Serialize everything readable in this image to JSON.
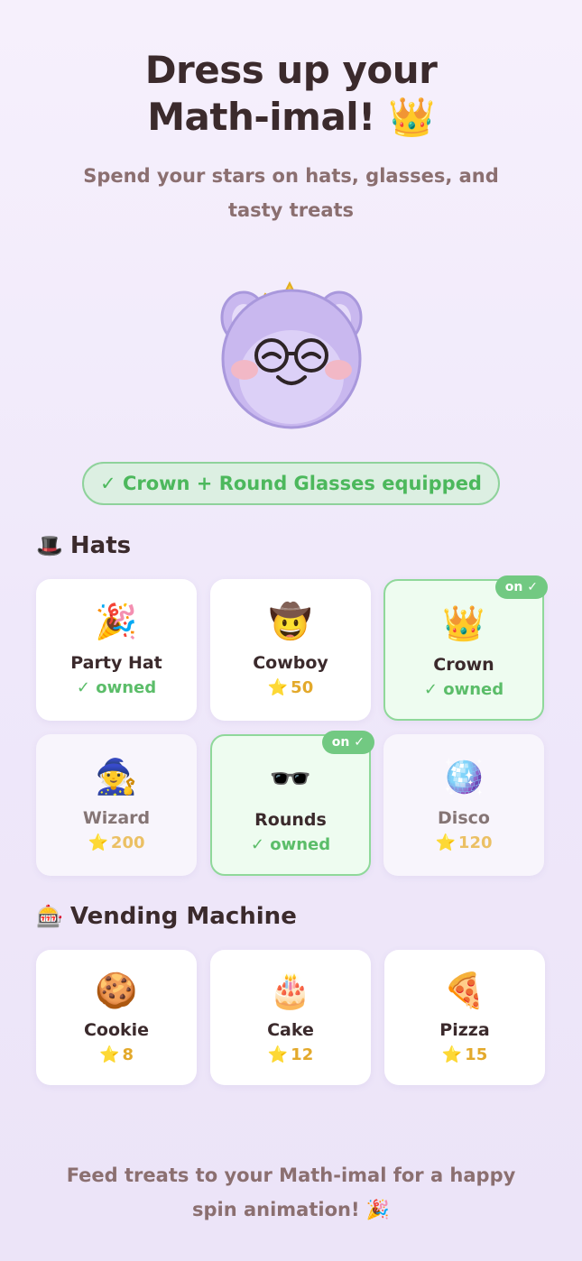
{
  "header": {
    "title_line1": "Dress up your",
    "title_line2": "Math-imal! 👑",
    "subtitle": "Spend your stars on hats, glasses, and tasty treats"
  },
  "status": {
    "equipped_text": "✓ Crown + Round Glasses equipped"
  },
  "hats": {
    "title": "Hats",
    "icon": "🎩",
    "items": [
      {
        "icon": "🎉",
        "name": "Party Hat",
        "status": "✓ owned"
      },
      {
        "icon": "🤠",
        "name": "Cowboy",
        "price": "50"
      },
      {
        "icon": "👑",
        "name": "Crown",
        "status": "✓ owned",
        "badge": "on ✓"
      },
      {
        "icon": "🧙",
        "name": "Wizard",
        "price": "200"
      },
      {
        "icon": "🕶️",
        "name": "Rounds",
        "status": "✓ owned",
        "badge": "on ✓"
      },
      {
        "icon": "🪩",
        "name": "Disco",
        "price": "120"
      }
    ]
  },
  "vending": {
    "title": "Vending Machine",
    "icon": "🎰",
    "items": [
      {
        "icon": "🍪",
        "name": "Cookie",
        "price": "8"
      },
      {
        "icon": "🎂",
        "name": "Cake",
        "price": "12"
      },
      {
        "icon": "🍕",
        "name": "Pizza",
        "price": "15"
      }
    ]
  },
  "footer": {
    "text": "Feed treats to your Math-imal for a happy spin animation! 🎉"
  },
  "colors": {
    "accent_green": "#5bbd69",
    "star_gold": "#e3a92b",
    "mascot_purple": "#c9b8ef"
  }
}
